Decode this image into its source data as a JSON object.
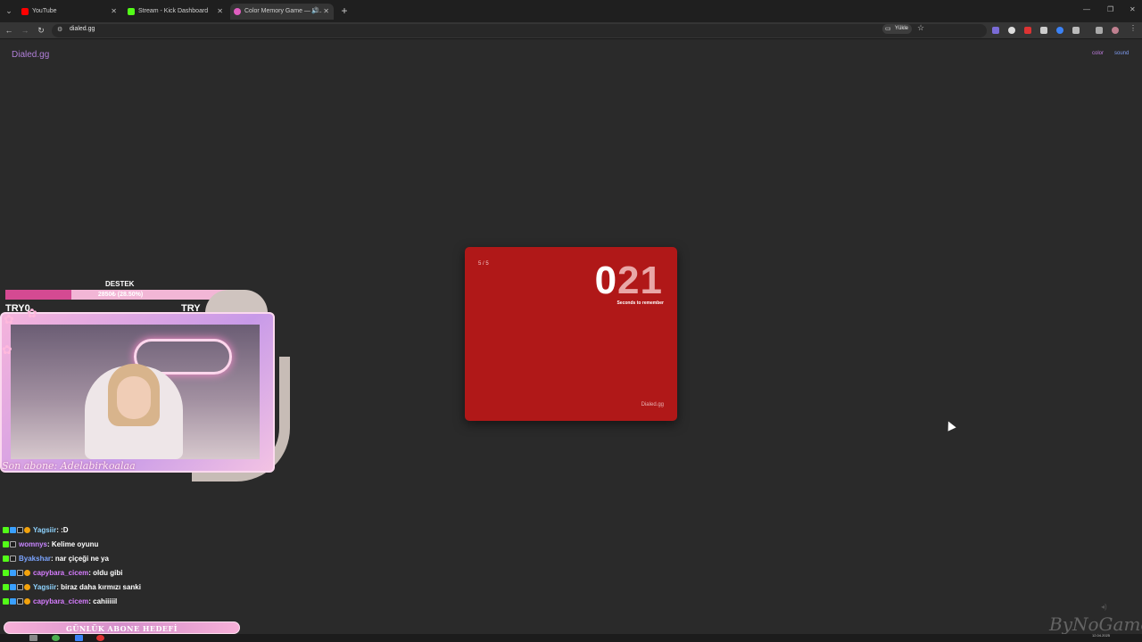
{
  "browser": {
    "tabs": [
      {
        "title": "YouTube",
        "favicon_color": "#ff0000",
        "active": false
      },
      {
        "title": "Stream - Kick Dashboard",
        "favicon_color": "#53fc18",
        "active": false
      },
      {
        "title": "Color Memory Game — H...",
        "favicon_color": "#e05ec0",
        "active": true
      }
    ],
    "new_tab": "+",
    "url": "dialed.gg",
    "install_label": "Yükle"
  },
  "page": {
    "brand": "Dialed.gg",
    "links": {
      "color": "color",
      "sound": "sound"
    },
    "accent_color": "#b07fd8",
    "card": {
      "background": "#b01818",
      "round_counter": "5 / 5",
      "timer_lead": "0",
      "timer_rest": "21",
      "timer_caption": "Seconds to remember",
      "watermark": "Dialed.gg"
    }
  },
  "stream_overlay": {
    "goal_title": "DESTEK",
    "goal_progress_text": "2850₺ (28.50%)",
    "goal_progress": 0.285,
    "try_left": "TRY0",
    "try_right": "TRY",
    "last_sub": "Son abone: Adelabirkoalaa",
    "chat": [
      {
        "user": "Yagsiir",
        "message": ": :D",
        "user_color": "#8fd4ff",
        "badges": [
          "kick",
          "sub",
          "mod",
          "coin"
        ]
      },
      {
        "user": "womnys",
        "message": ": Kelime oyunu",
        "user_color": "#c785ff",
        "badges": [
          "kick",
          "mod"
        ]
      },
      {
        "user": "Byakshar",
        "message": ": nar çiçeği ne ya",
        "user_color": "#7ba4ff",
        "badges": [
          "kick",
          "mod"
        ]
      },
      {
        "user": "capybara_cicem",
        "message": ": oldu gibi",
        "user_color": "#d77dff",
        "badges": [
          "kick",
          "sub",
          "mod",
          "coin"
        ]
      },
      {
        "user": "Yagsiir",
        "message": ": biraz daha kırmızı sanki",
        "user_color": "#8fd4ff",
        "badges": [
          "kick",
          "sub",
          "mod",
          "coin"
        ]
      },
      {
        "user": "capybara_cicem",
        "message": ": cahiiiiil",
        "user_color": "#d77dff",
        "badges": [
          "kick",
          "sub",
          "mod",
          "coin"
        ]
      }
    ],
    "daily_goal": "GÜNLÜK ABONE HEDEFİ"
  },
  "taskbar": {
    "date": "12.04.2025"
  }
}
